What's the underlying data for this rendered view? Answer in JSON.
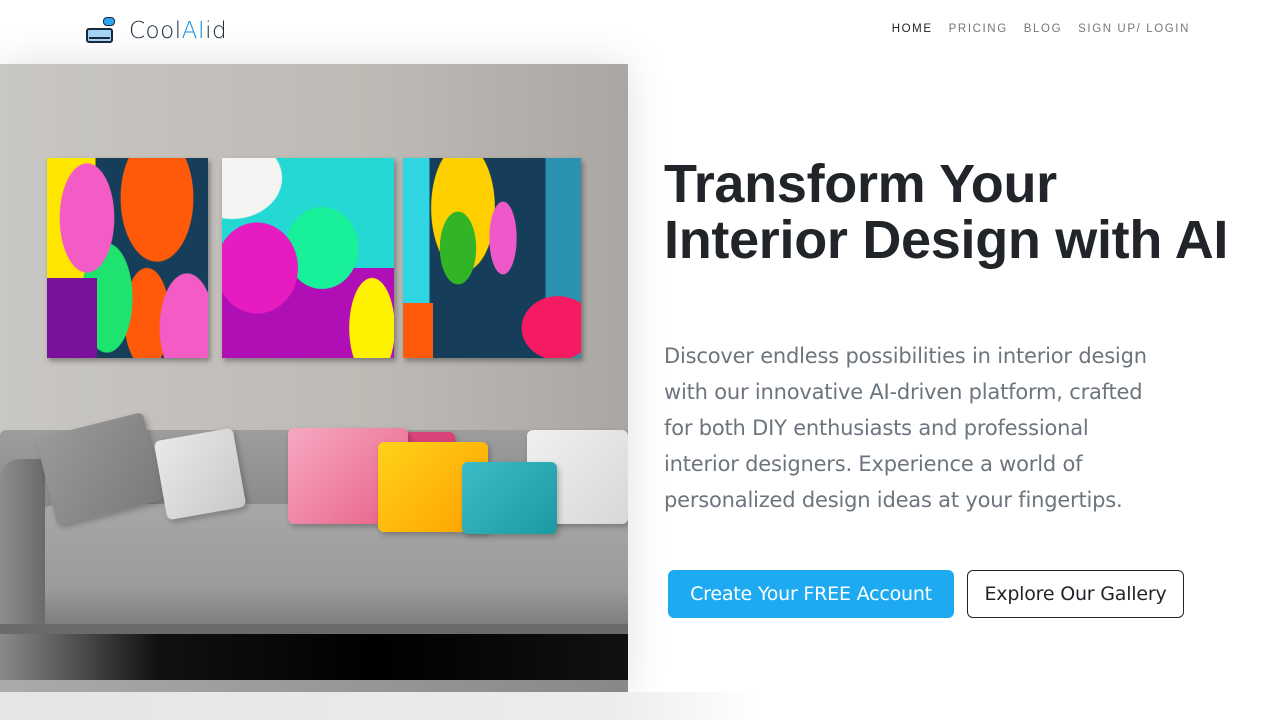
{
  "header": {
    "logo": {
      "prefix": "Cool",
      "highlight": "AI",
      "suffix": "id",
      "icon": "sofa-logo-icon"
    },
    "nav": [
      {
        "label": "HOME",
        "active": true
      },
      {
        "label": "PRICING",
        "active": false
      },
      {
        "label": "BLOG",
        "active": false
      },
      {
        "label": "SIGN UP/ LOGIN",
        "active": false
      }
    ]
  },
  "hero": {
    "image": {
      "description": "Living room with grey sofa, colorful pillows and three abstract canvas paintings"
    },
    "title": "Transform Your Interior Design with AI",
    "description": "Discover endless possibilities in interior design with our innovative AI-driven platform, crafted for both DIY enthusiasts and professional interior designers. Experience a world of personalized design ideas at your fingertips.",
    "primary_button": "Create Your FREE Account",
    "secondary_button": "Explore Our Gallery"
  },
  "colors": {
    "accent": "#1eaaf1",
    "logo_highlight": "#1e90e0",
    "title": "#212529",
    "body_text": "#6c757d"
  }
}
